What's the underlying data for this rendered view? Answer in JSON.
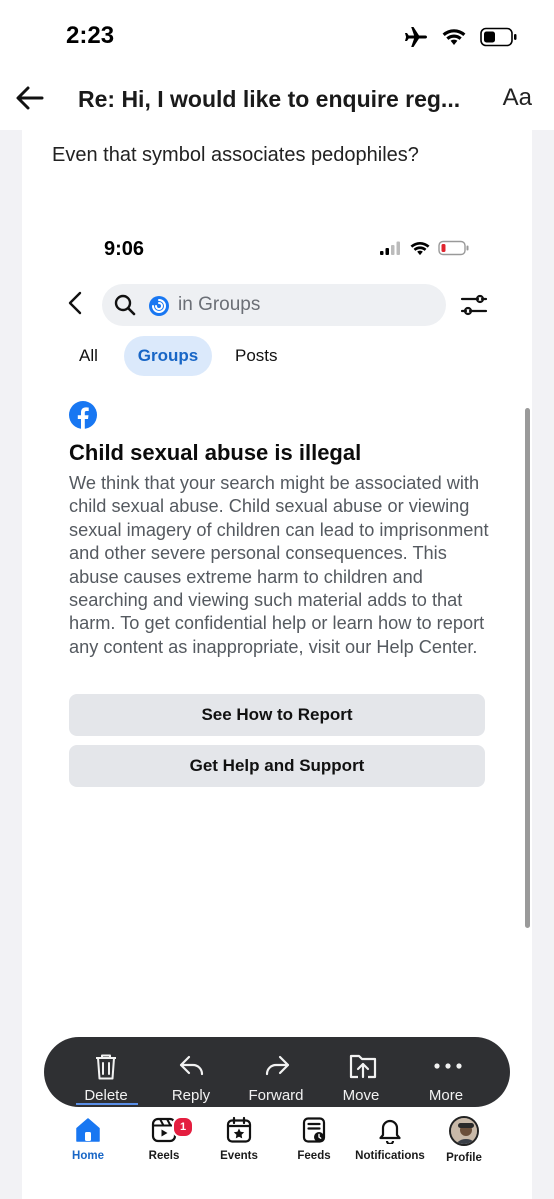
{
  "status_bar": {
    "time": "2:23"
  },
  "mail_header": {
    "subject": "Re: Hi, I would like to enquire reg...",
    "font_size_label": "Aa"
  },
  "mail_body": {
    "text": "Even that symbol associates pedophiles?"
  },
  "inner_screenshot": {
    "time": "9:06",
    "search": {
      "placeholder": "in Groups"
    },
    "tabs": [
      {
        "label": "All"
      },
      {
        "label": "Groups",
        "selected": true
      },
      {
        "label": "Posts"
      }
    ],
    "warning": {
      "title": "Child sexual abuse is illegal",
      "body": "We think that your search might be associated with child sexual abuse. Child sexual abuse or viewing sexual imagery of children can lead to imprisonment and other severe personal consequences. This abuse causes extreme harm to children and searching and viewing such material adds to that harm. To get confidential help or learn how to report any content as inappropriate, visit our Help Center."
    },
    "buttons": {
      "report": "See How to Report",
      "support": "Get Help and Support"
    }
  },
  "mail_toolbar": {
    "delete": "Delete",
    "reply": "Reply",
    "forward": "Forward",
    "move": "Move",
    "more": "More"
  },
  "bottom_nav": {
    "home": "Home",
    "reels": "Reels",
    "reels_badge": "1",
    "events": "Events",
    "feeds": "Feeds",
    "notifications": "Notifications",
    "profile": "Profile"
  },
  "colors": {
    "facebook_blue": "#1877f2",
    "selected_tab_bg": "#dbe9fb",
    "toolbar_bg": "#2f3033",
    "badge_red": "#e41e3f"
  }
}
